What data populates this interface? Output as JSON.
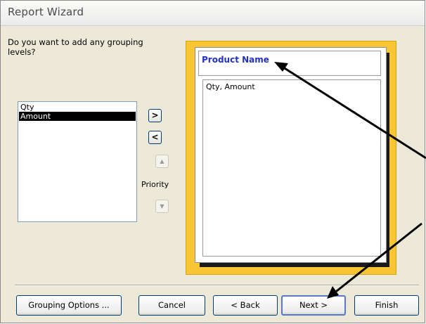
{
  "window": {
    "title": "Report Wizard"
  },
  "prompt": {
    "question": "Do you want to add any grouping levels?"
  },
  "fields_list": {
    "items": [
      {
        "label": "Qty",
        "selected": false
      },
      {
        "label": "Amount",
        "selected": true
      }
    ]
  },
  "controls": {
    "add_level": ">",
    "remove_level": "<",
    "priority_up_glyph": "▲",
    "priority_down_glyph": "▼",
    "priority_label": "Priority"
  },
  "preview": {
    "group_header": "Product Name",
    "detail_fields": "Qty, Amount"
  },
  "buttons": {
    "grouping_options": "Grouping Options ...",
    "cancel": "Cancel",
    "back": "< Back",
    "next": "Next >",
    "finish": "Finish"
  },
  "colors": {
    "dialog_background": "#ece9d8",
    "preview_frame": "#f8c534",
    "group_header_text": "#2330c0",
    "selection": "#000000",
    "annotation_arrow": "#000000"
  },
  "icons": {
    "annotation": "arrow-icon"
  }
}
